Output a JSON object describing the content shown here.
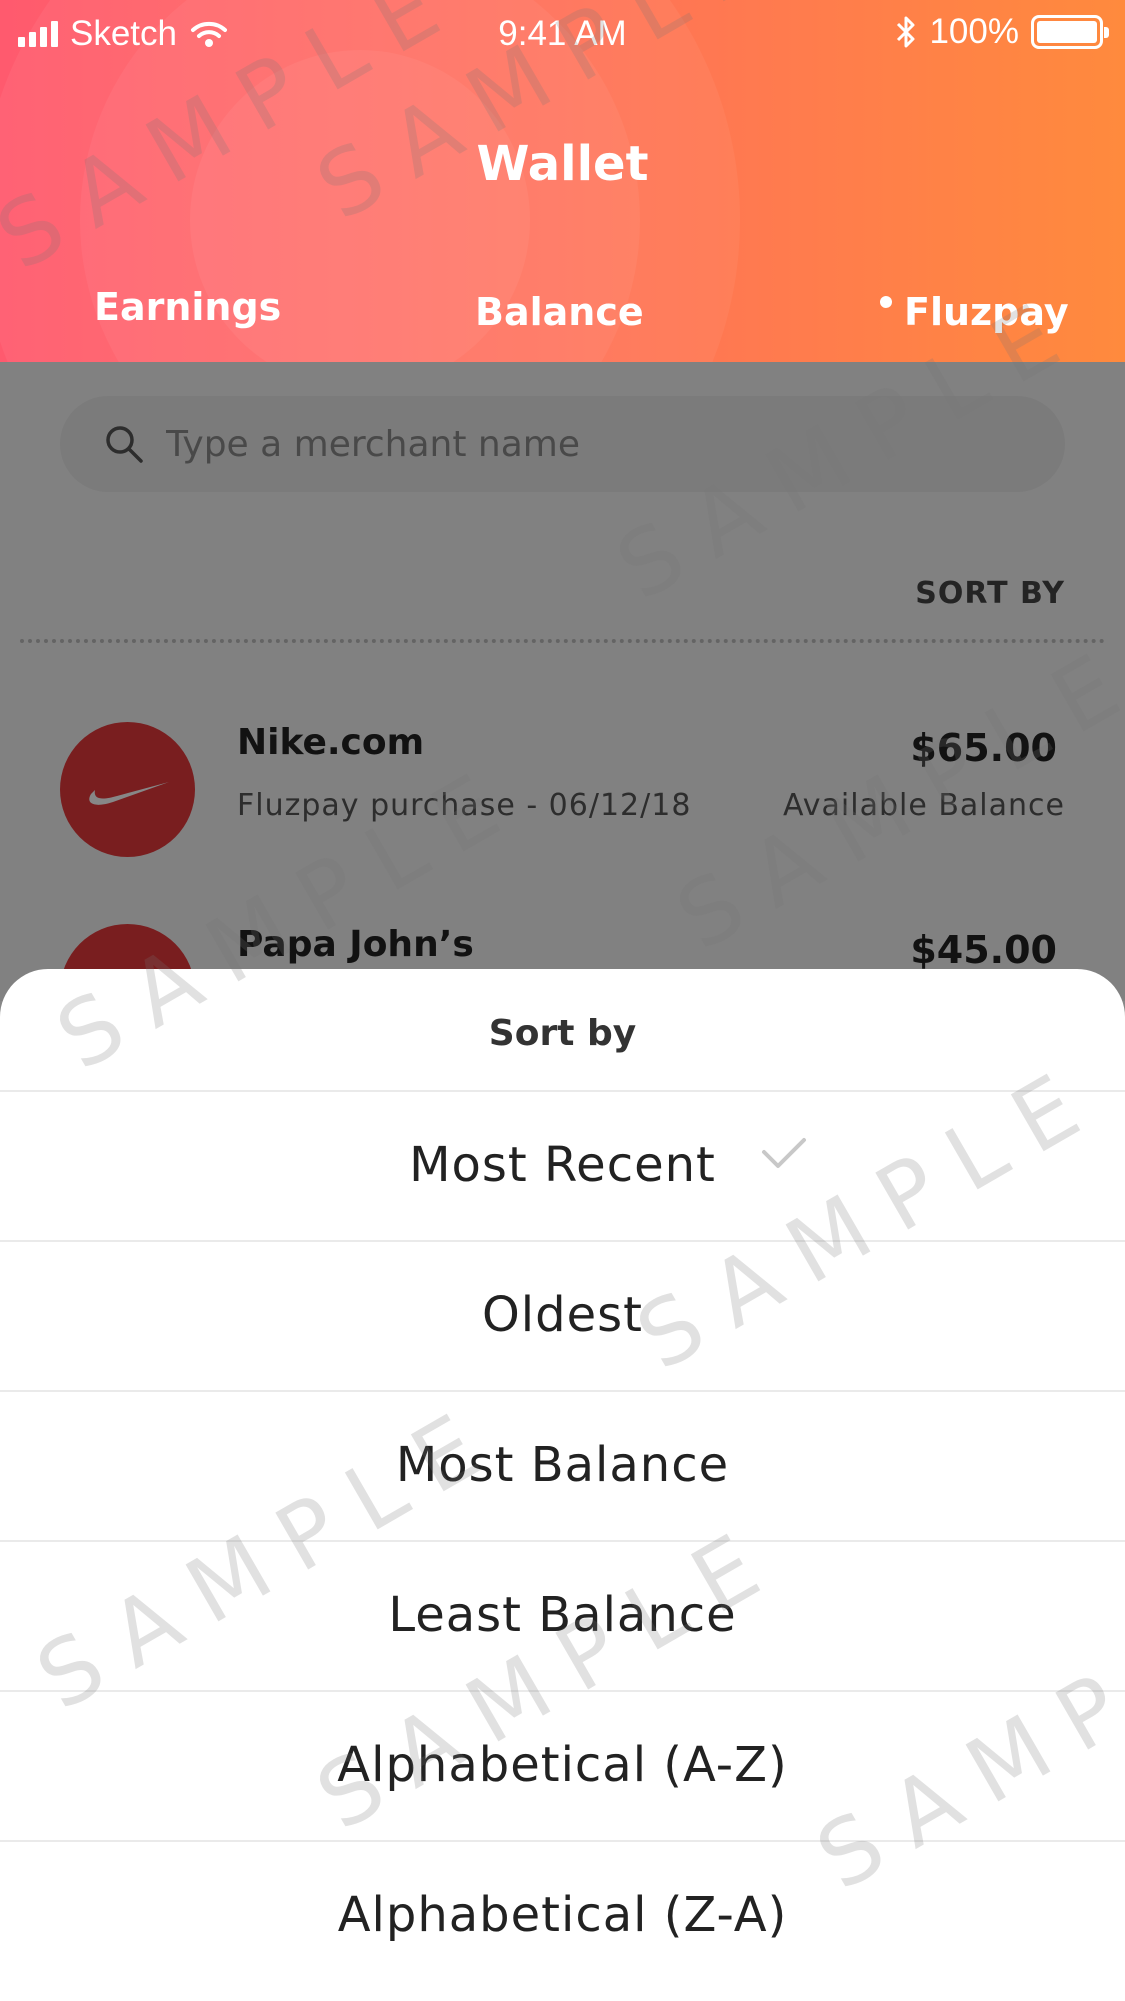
{
  "status_bar": {
    "carrier": "Sketch",
    "time": "9:41 AM",
    "battery": "100%",
    "battery_level": 1.0
  },
  "header": {
    "title": "Wallet",
    "tabs": [
      {
        "label": "Earnings"
      },
      {
        "label": "Balance"
      },
      {
        "label": "Fluzpay",
        "active": true
      }
    ],
    "colors": {
      "gradient_start": "#ff5a6e",
      "gradient_end": "#ff8a3d"
    }
  },
  "search": {
    "placeholder": "Type a merchant name",
    "icon": "search-icon"
  },
  "sort_link": "SORT BY",
  "transactions": [
    {
      "merchant": "Nike.com",
      "subtitle": "Fluzpay purchase - 06/12/18",
      "amount": "$65.00",
      "amount_label": "Available Balance",
      "icon": "nike-swoosh-icon"
    },
    {
      "merchant": "Papa John’s",
      "amount": "$45.00",
      "icon": "papa-johns-logo-icon"
    }
  ],
  "sort_sheet": {
    "title": "Sort by",
    "options": [
      {
        "label": "Most Recent",
        "selected": true
      },
      {
        "label": "Oldest"
      },
      {
        "label": "Most Balance"
      },
      {
        "label": "Least Balance"
      },
      {
        "label": "Alphabetical (A-Z)"
      },
      {
        "label": "Alphabetical (Z-A)"
      }
    ]
  },
  "watermark": "SAMPLE"
}
